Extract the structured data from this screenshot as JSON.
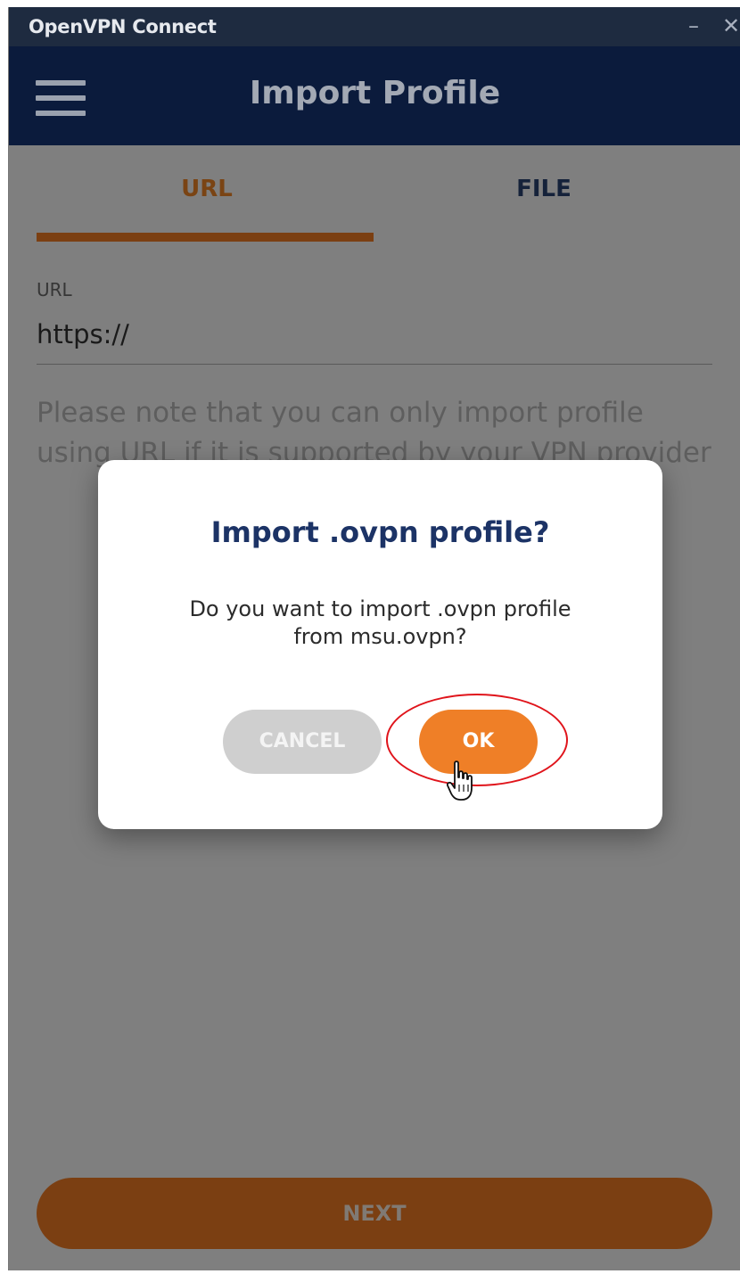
{
  "window": {
    "app_title": "OpenVPN Connect",
    "minimize_symbol": "–",
    "close_symbol": "✕"
  },
  "appbar": {
    "menu_icon": "hamburger-menu-icon",
    "title": "Import Profile"
  },
  "tabs": [
    {
      "label": "URL",
      "active": true
    },
    {
      "label": "FILE",
      "active": false
    }
  ],
  "url_field": {
    "label": "URL",
    "value": "https://"
  },
  "note": "Please note that you can only import profile using URL if it is supported by your VPN provider",
  "next_button": {
    "label": "NEXT"
  },
  "dialog": {
    "title": "Import .ovpn profile?",
    "message_line1": "Do you want to import .ovpn profile",
    "message_line2": "from msu.ovpn?",
    "cancel_label": "CANCEL",
    "ok_label": "OK"
  },
  "colors": {
    "accent_orange": "#ef7f27",
    "appbar_navy": "#0b1b3c",
    "dialog_title_blue": "#1c3366",
    "highlight_red": "#e0141b"
  }
}
